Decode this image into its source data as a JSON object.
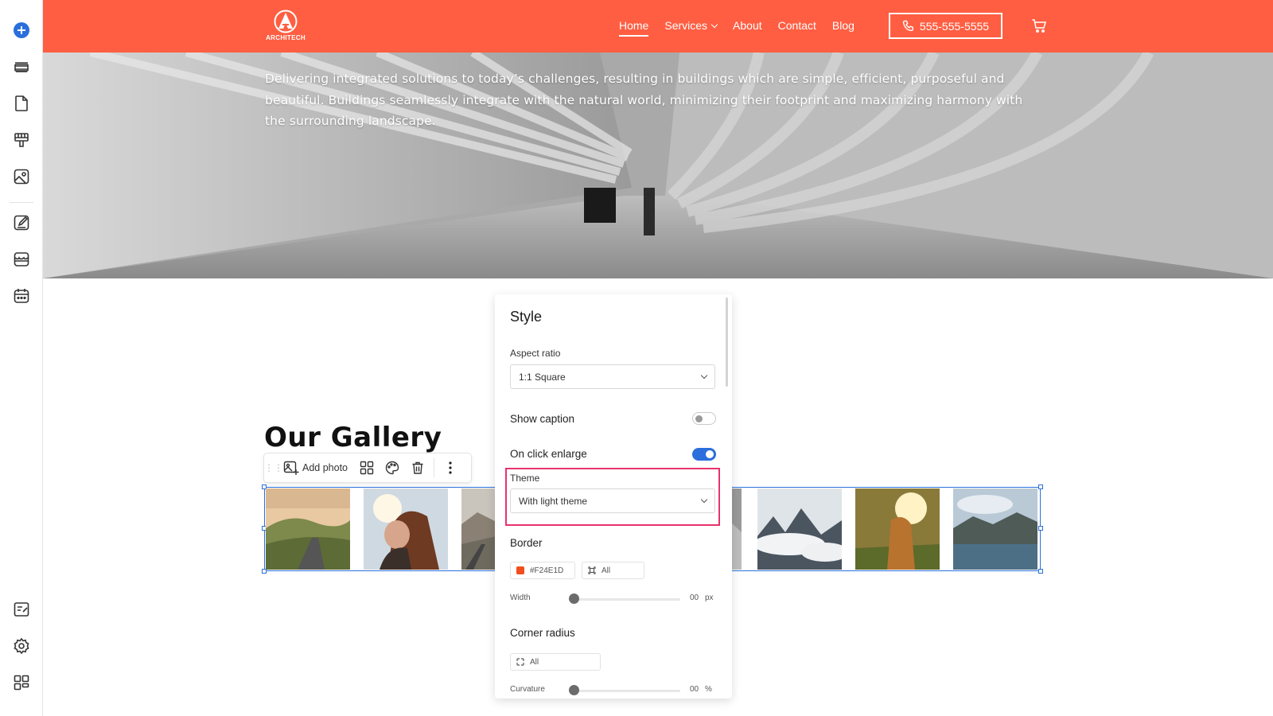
{
  "rail": {
    "items": [
      "add-icon",
      "sections-icon",
      "pages-icon",
      "theme-icon",
      "media-icon",
      "blog-icon",
      "store-icon",
      "calendar-icon",
      "marketing-icon",
      "settings-icon",
      "apps-icon"
    ]
  },
  "header": {
    "logo_text": "ARCHITECH",
    "nav": [
      "Home",
      "Services",
      "About",
      "Contact",
      "Blog"
    ],
    "phone": "555-555-5555",
    "brand_color": "#FF5E42"
  },
  "hero": {
    "text": "Delivering integrated solutions to today’s challenges, resulting in buildings which are simple, efficient, purposeful and beautiful. Buildings seamlessly integrate with the natural world, minimizing their footprint and maximizing harmony with the surrounding landscape."
  },
  "gallery": {
    "title": "Our Gallery",
    "toolbar": {
      "add_photo": "Add photo"
    },
    "photos": [
      "road-landscape",
      "couple-portrait",
      "mountain-road",
      "misty-peaks",
      "woman-sunset",
      "lake-mountains"
    ]
  },
  "style_panel": {
    "title": "Style",
    "aspect_ratio_label": "Aspect ratio",
    "aspect_ratio_value": "1:1 Square",
    "show_caption_label": "Show caption",
    "show_caption": false,
    "on_click_enlarge_label": "On click enlarge",
    "on_click_enlarge": true,
    "theme_label": "Theme",
    "theme_value": "With light theme",
    "border_label": "Border",
    "border_color": "#F24E1D",
    "border_color_text": "#F24E1D",
    "border_sides": "All",
    "width_label": "Width",
    "width_value": "00",
    "width_unit": "px",
    "corner_radius_label": "Corner radius",
    "corner_sides": "All",
    "curvature_label": "Curvature",
    "curvature_value": "00",
    "curvature_unit": "%",
    "highlight_color": "#E8336D",
    "accent_color": "#2A6FDB"
  }
}
